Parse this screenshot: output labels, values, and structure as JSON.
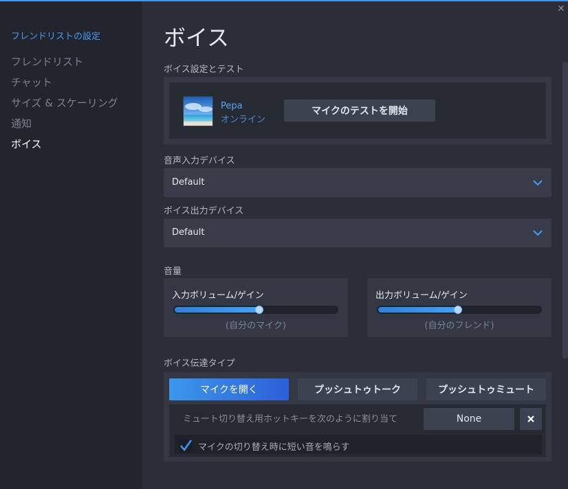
{
  "sidebar": {
    "header": "フレンドリストの設定",
    "items": [
      {
        "label": "フレンドリスト",
        "active": false
      },
      {
        "label": "チャット",
        "active": false
      },
      {
        "label": "サイズ & スケーリング",
        "active": false
      },
      {
        "label": "通知",
        "active": false
      },
      {
        "label": "ボイス",
        "active": true
      }
    ]
  },
  "window": {
    "close_icon": "close-icon"
  },
  "main": {
    "title": "ボイス",
    "voice_test": {
      "section_label": "ボイス設定とテスト",
      "user_name": "Pepa",
      "user_status": "オンライン",
      "test_button": "マイクのテストを開始"
    },
    "input_device": {
      "label": "音声入力デバイス",
      "value": "Default"
    },
    "output_device": {
      "label": "ボイス出力デバイス",
      "value": "Default"
    },
    "volume": {
      "section_label": "音量",
      "input": {
        "title": "入力ボリューム/ゲイン",
        "sub": "(自分のマイク)",
        "level": 0.52
      },
      "output": {
        "title": "出力ボリューム/ゲイン",
        "sub": "(自分のフレンド)",
        "level": 0.49
      }
    },
    "transmission": {
      "section_label": "ボイス伝達タイプ",
      "modes": [
        "マイクを開く",
        "プッシュトゥトーク",
        "プッシュトゥミュート"
      ],
      "selected_mode": "マイクを開く",
      "hotkey_label": "ミュート切り替え用ホットキーを次のように割り当て",
      "hotkey_value": "None",
      "clear_icon": "close-icon",
      "checkbox_label": "マイクの切り替え時に短い音を鳴らす",
      "checkbox_checked": true
    }
  },
  "colors": {
    "accent": "#4196e6",
    "sidebar_bg": "#22252d",
    "main_bg": "#2b2e38",
    "panel_bg": "#343844",
    "active_text": "#ffffff",
    "link_text": "#4a9cf0"
  }
}
